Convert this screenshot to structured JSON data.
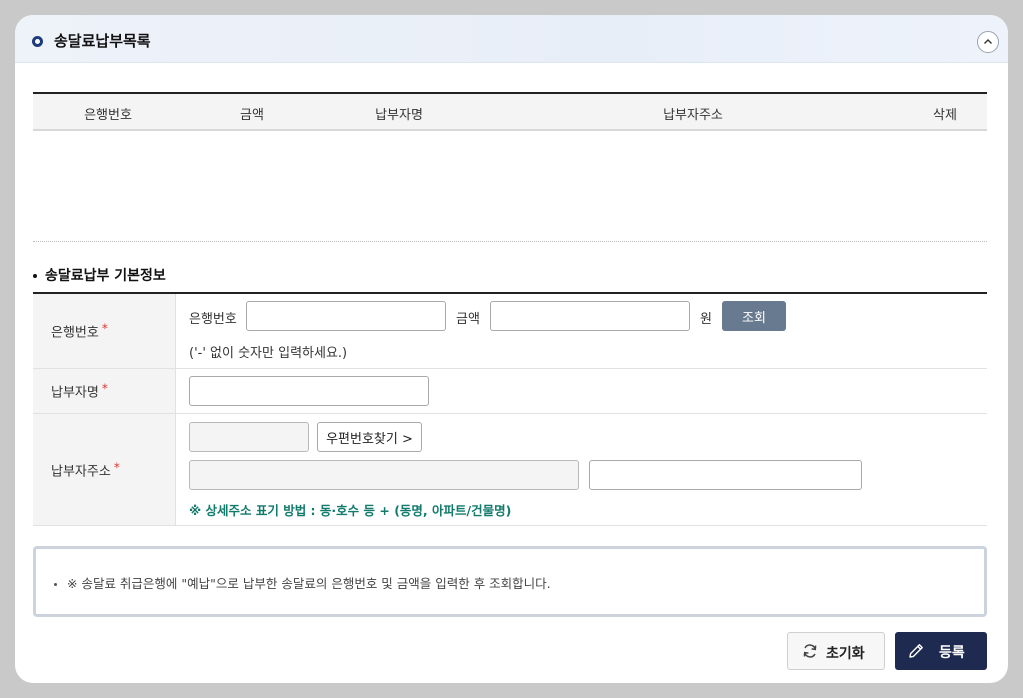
{
  "panel": {
    "title": "송달료납부목록",
    "collapse_glyph": "︿"
  },
  "list": {
    "headers": [
      "은행번호",
      "금액",
      "납부자명",
      "납부자주소",
      "삭제"
    ]
  },
  "section": {
    "title": "송달료납부 기본정보"
  },
  "form": {
    "bank_row": {
      "label": "은행번호",
      "required_mark": "*",
      "bank_label": "은행번호",
      "bank_value": "",
      "amount_label": "금액",
      "amount_value": "",
      "unit": "원",
      "search_button": "조회",
      "note": "('-' 없이 숫자만 입력하세요.)"
    },
    "payer_row": {
      "label": "납부자명",
      "required_mark": "*",
      "value": ""
    },
    "address_row": {
      "label": "납부자주소",
      "required_mark": "*",
      "zip_value": "",
      "zip_button": "우편번호찾기 >",
      "address_value": "",
      "detail_value": "",
      "hint": "※ 상세주소 표기 방법 : 동·호수 등 + (동명, 아파트/건물명)"
    }
  },
  "notice": {
    "text": "※ 송달료 취급은행에 \"예납\"으로 납부한 송달료의 은행번호 및 금액을 입력한 후 조회합니다."
  },
  "actions": {
    "reset_label": "초기화",
    "save_label": "등록"
  },
  "colors": {
    "save_button": "#1e2a4f",
    "search_button": "#687a90",
    "hint_text": "#137b6c",
    "required": "#d33333"
  }
}
